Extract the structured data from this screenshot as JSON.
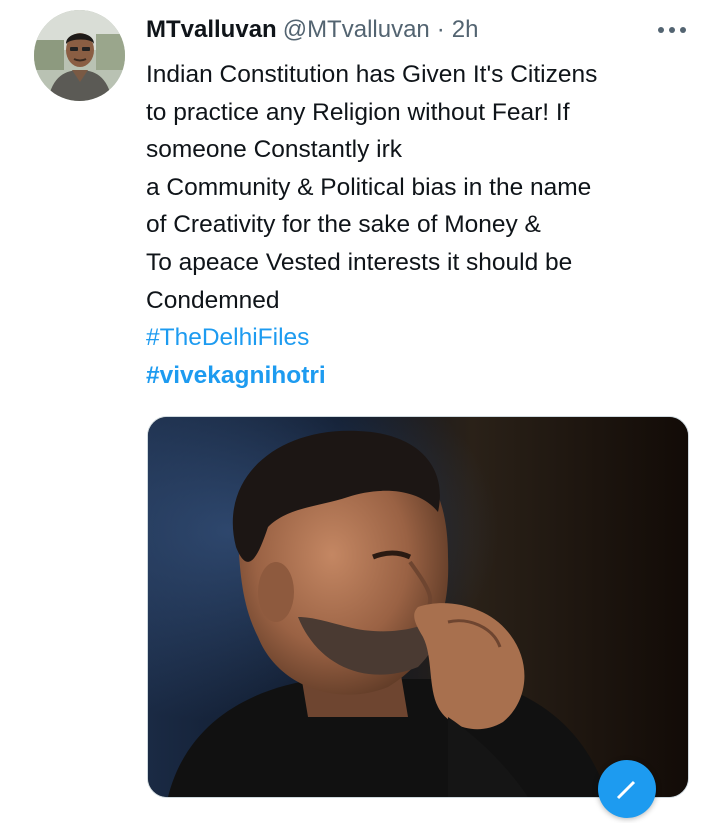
{
  "tweet": {
    "display_name": "MTvalluvan",
    "handle": "@MTvalluvan",
    "separator": "·",
    "timestamp": "2h",
    "body_lines": [
      "Indian Constitution has Given It's Citizens",
      "to practice any Religion without Fear! If",
      "someone Constantly irk",
      "a Community & Political bias in the name",
      "of Creativity for the sake of Money &",
      "To apeace Vested interests it should be",
      "Condemned"
    ],
    "hashtags": [
      "#TheDelhiFiles",
      "#vivekagnihotri"
    ]
  },
  "icons": {
    "more": "more-horizontal-icon",
    "fab": "compose-tweet-icon"
  },
  "colors": {
    "link": "#1d9bf0",
    "text": "#0f1419",
    "secondary": "#536471",
    "border": "#cfd9de"
  }
}
